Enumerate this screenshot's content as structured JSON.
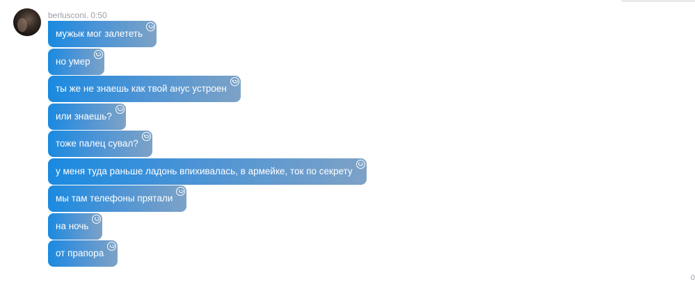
{
  "header": {
    "author": "berlusconi.",
    "time": "0:50"
  },
  "messages": [
    {
      "text": "мужык мог залететь",
      "icon": "smile-icon"
    },
    {
      "text": "но умер",
      "icon": "smile-icon"
    },
    {
      "text": "ты же не знаешь как твой анус устроен",
      "icon": "smile-icon"
    },
    {
      "text": "или знаешь?",
      "icon": "smile-icon"
    },
    {
      "text": "тоже палец сувал?",
      "icon": "smile-icon"
    },
    {
      "text": "у меня туда раньше ладонь впихивалась, в армейке, ток по секрету",
      "icon": "smile-icon"
    },
    {
      "text": "мы там телефоны прятали",
      "icon": "smile-icon"
    },
    {
      "text": "на ночь",
      "icon": "smile-icon"
    },
    {
      "text": "от прапора",
      "icon": "smile-icon"
    }
  ],
  "footer": {
    "counter": "0"
  },
  "colors": {
    "bubble_start": "#1a8ae0",
    "bubble_end": "#7da2c6",
    "meta_text": "#9b9fa6"
  }
}
